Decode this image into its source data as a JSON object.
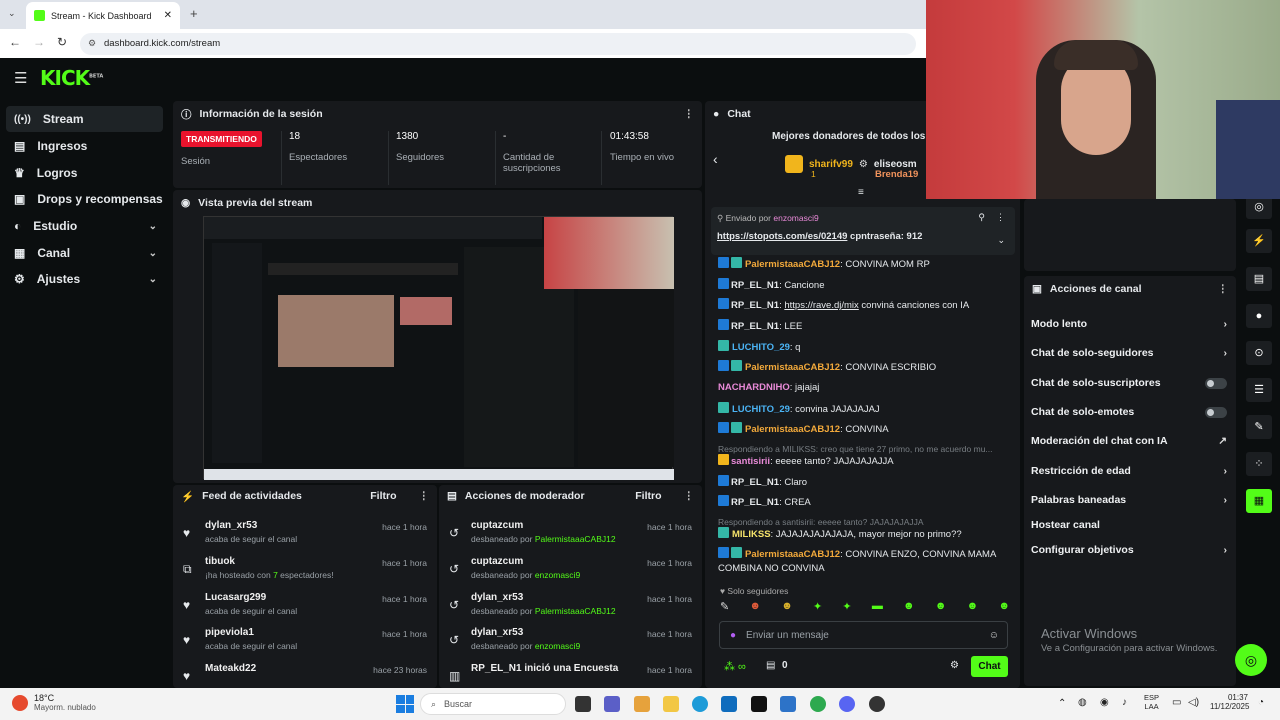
{
  "browser": {
    "tab_title": "Stream - Kick Dashboard",
    "new_tab": "+",
    "url": "dashboard.kick.com/stream"
  },
  "brand": {
    "logo": "KICK",
    "beta": "BETA"
  },
  "sidebar": {
    "items": [
      {
        "label": "Stream",
        "icon": "broadcast-icon"
      },
      {
        "label": "Ingresos",
        "icon": "wallet-icon"
      },
      {
        "label": "Logros",
        "icon": "trophy-icon"
      },
      {
        "label": "Drops y recompensas",
        "icon": "gift-icon"
      },
      {
        "label": "Estudio",
        "icon": "palette-icon"
      },
      {
        "label": "Canal",
        "icon": "grid-icon"
      },
      {
        "label": "Ajustes",
        "icon": "gear-icon"
      }
    ]
  },
  "session": {
    "title": "Información de la sesión",
    "status": "TRANSMITIENDO",
    "status_label": "Sesión",
    "stats": [
      {
        "value": "18",
        "label": "Espectadores"
      },
      {
        "value": "1380",
        "label": "Seguidores"
      },
      {
        "value": "-",
        "label": "Cantidad de suscripciones"
      },
      {
        "value": "01:43:58",
        "label": "Tiempo en vivo"
      }
    ]
  },
  "preview": {
    "title": "Vista previa del stream"
  },
  "feed": {
    "title": "Feed de actividades",
    "filter": "Filtro",
    "items": [
      {
        "name": "dylan_xr53",
        "sub": "acaba de seguir el canal",
        "time": "hace 1 hora",
        "icon": "heart-icon"
      },
      {
        "name": "tibuok",
        "sub_pre": "¡ha hosteado con ",
        "sub_count": "7",
        "sub_post": " espectadores!",
        "time": "hace 1 hora",
        "icon": "host-icon"
      },
      {
        "name": "Lucasarg299",
        "sub": "acaba de seguir el canal",
        "time": "hace 1 hora",
        "icon": "heart-icon"
      },
      {
        "name": "pipeviola1",
        "sub": "acaba de seguir el canal",
        "time": "hace 1 hora",
        "icon": "heart-icon"
      },
      {
        "name": "Mateakd22",
        "sub": "",
        "time": "hace 23 horas",
        "icon": "heart-icon"
      }
    ]
  },
  "mod": {
    "title": "Acciones de moderador",
    "filter": "Filtro",
    "items": [
      {
        "name": "cuptazcum",
        "sub": "desbaneado por ",
        "by": "PalermistaaaCABJ12",
        "time": "hace 1 hora"
      },
      {
        "name": "cuptazcum",
        "sub": "desbaneado por ",
        "by": "enzomasci9",
        "time": "hace 1 hora"
      },
      {
        "name": "dylan_xr53",
        "sub": "desbaneado por ",
        "by": "PalermistaaaCABJ12",
        "time": "hace 1 hora"
      },
      {
        "name": "dylan_xr53",
        "sub": "desbaneado por ",
        "by": "enzomasci9",
        "time": "hace 1 hora"
      },
      {
        "name": "RP_EL_N1",
        "sub": " inició una Encuesta",
        "by": "",
        "time": "hace 1 hora"
      }
    ]
  },
  "chat": {
    "title": "Chat",
    "donors_title": "Mejores donadores de todos los ti",
    "donors": [
      {
        "name": "sharifv99",
        "count": "1"
      },
      {
        "name": "eliseosm"
      },
      {
        "name": "Brenda19"
      }
    ],
    "pinned": {
      "sent_by": "Enviado por",
      "user": "enzomasci9",
      "link": "https://stopots.com/es/02149",
      "text": " cpntraseña: 912"
    },
    "messages": [
      {
        "user": "PalermistaaaCABJ12",
        "text": ": CONVINA MOM RP",
        "color": "#f2a93b"
      },
      {
        "user": "RP_EL_N1",
        "text": ": Cancione",
        "color": "#e6e9ec"
      },
      {
        "user": "RP_EL_N1",
        "link": "https://rave.dj/mix",
        "text": " conviná canciones con IA",
        "color": "#e6e9ec"
      },
      {
        "user": "RP_EL_N1",
        "text": ": LEE",
        "color": "#e6e9ec"
      },
      {
        "user": "LUCHITO_29",
        "text": ": q",
        "color": "#4bb4f5"
      },
      {
        "user": "PalermistaaaCABJ12",
        "text": ": CONVINA ESCRIBIO",
        "color": "#f2a93b"
      },
      {
        "user": "NACHARDNIHO",
        "text": ": jajajaj",
        "color": "#e98ad8"
      },
      {
        "user": "LUCHITO_29",
        "text": ": convina JAJAJAJAJ",
        "color": "#4bb4f5"
      },
      {
        "user": "PalermistaaaCABJ12",
        "text": ": CONVINA",
        "color": "#f2a93b"
      },
      {
        "reply": "Respondiendo a MILIKSS: creo que tiene 27 primo, no me acuerdo mu..."
      },
      {
        "user": "santisirii",
        "text": ": eeeee tanto? JAJAJAJAJJA",
        "color": "#e98ad8"
      },
      {
        "user": "RP_EL_N1",
        "text": ": Claro",
        "color": "#e6e9ec"
      },
      {
        "user": "RP_EL_N1",
        "text": ": CREA",
        "color": "#e6e9ec"
      },
      {
        "reply": "Respondiendo a santisirii: eeeee tanto? JAJAJAJAJJA"
      },
      {
        "user": "MILIKSS",
        "text": ": JAJAJAJAJAJAJA, mayor mejor no primo??",
        "color": "#f5e36b"
      },
      {
        "user": "PalermistaaaCABJ12",
        "text": ": CONVINA ENZO, CONVINA MAMA COMBINA NO CONVINA",
        "color": "#f2a93b"
      }
    ],
    "followers_only": "Solo seguidores",
    "input_placeholder": "Enviar un mensaje",
    "points": "0",
    "send_label": "Chat"
  },
  "channel_actions": {
    "title": "Acciones de canal",
    "items": [
      {
        "label": "Modo lento",
        "type": "arrow"
      },
      {
        "label": "Chat de solo-seguidores",
        "type": "arrow"
      },
      {
        "label": "Chat de solo-suscriptores",
        "type": "toggle"
      },
      {
        "label": "Chat de solo-emotes",
        "type": "toggle"
      },
      {
        "label": "Moderación del chat con IA",
        "type": "external"
      },
      {
        "label": "Restricción de edad",
        "type": "arrow"
      },
      {
        "label": "Palabras baneadas",
        "type": "arrow"
      },
      {
        "label": "Hostear canal",
        "type": "none"
      },
      {
        "label": "Configurar objetivos",
        "type": "arrow"
      }
    ]
  },
  "watermark": {
    "title": "Activar Windows",
    "sub": "Ve a Configuración para activar Windows."
  },
  "taskbar": {
    "weather_temp": "18°C",
    "weather_desc": "Mayorm. nublado",
    "search": "Buscar",
    "lang": "ESP",
    "lang2": "LAA",
    "time": "01:37",
    "date": "11/12/2025"
  },
  "colors": {
    "accent": "#53fc18",
    "live": "#e9132d",
    "panel": "#17191c"
  }
}
